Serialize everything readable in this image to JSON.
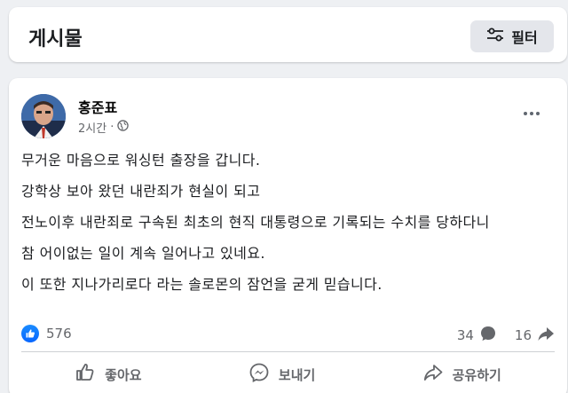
{
  "header": {
    "title": "게시물",
    "filter_label": "필터",
    "filter_icon": "sliders-icon"
  },
  "post": {
    "author": "홍준표",
    "time": "2시간",
    "separator": "·",
    "privacy_icon": "globe-icon",
    "more_icon": "more-horizontal-icon",
    "lines": [
      "무거운 마음으로 워싱턴 출장을 갑니다.",
      "강학상 보아 왔던 내란죄가 현실이 되고",
      "전노이후 내란죄로 구속된 최초의 현직 대통령으로 기록되는 수치를 당하다니",
      "참 어이없는 일이 계속 일어나고 있네요.",
      "이 또한 지나가리로다 라는 솔로몬의 잠언을 굳게 믿습니다."
    ],
    "like_count": "576",
    "comment_count": "34",
    "share_count": "16"
  },
  "actions": {
    "like": "좋아요",
    "send": "보내기",
    "share": "공유하기"
  },
  "colors": {
    "accent": "#0866ff",
    "muted_text": "#65676b",
    "background": "#eef0f3"
  }
}
